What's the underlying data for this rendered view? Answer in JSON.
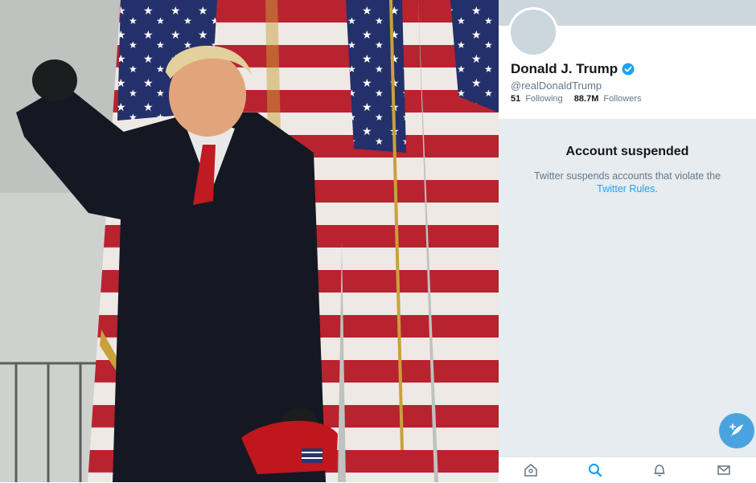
{
  "photo": {
    "subject": "man-raising-fist-before-flags",
    "cap_flag": "us-flag"
  },
  "profile": {
    "display_name": "Donald J. Trump",
    "handle": "@realDonaldTrump",
    "following_count": "51",
    "following_label": "Following",
    "followers_count": "88.7M",
    "followers_label": "Followers",
    "verified_icon": "verified-badge-icon"
  },
  "suspension": {
    "title": "Account suspended",
    "message": "Twitter suspends accounts that violate the",
    "link_text": "Twitter Rules",
    "suffix": "."
  },
  "compose_icon": "compose-tweet-icon",
  "tabs": [
    {
      "icon": "home-icon"
    },
    {
      "icon": "search-icon",
      "active": true
    },
    {
      "icon": "notifications-icon"
    },
    {
      "icon": "messages-icon"
    }
  ],
  "colors": {
    "accent": "#1da1f2",
    "panel_bg": "#e6ecf0",
    "banner": "#ccd6dd"
  }
}
